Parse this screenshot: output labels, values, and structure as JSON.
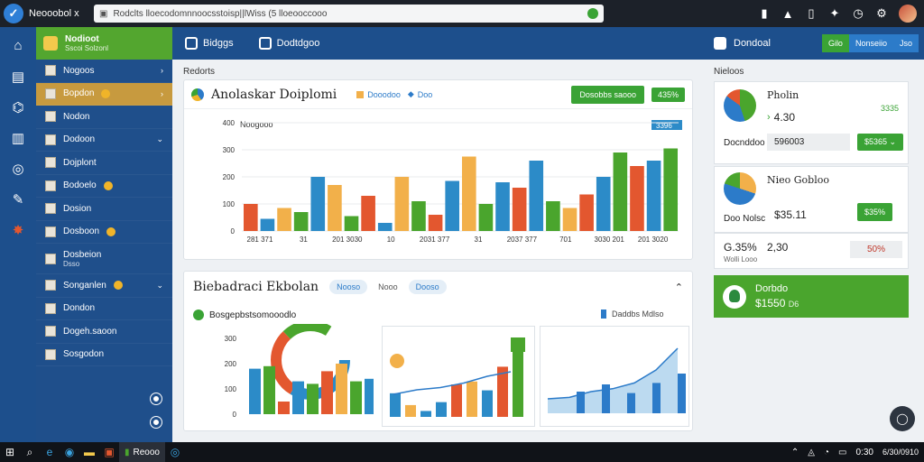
{
  "browser": {
    "tab_title": "Neooobol x",
    "url": "Rodclts  lloecodomnnoocsstoisp||lWiss (5  lloeooccooo",
    "icons": [
      "shield-icon",
      "warning-icon",
      "battery-icon",
      "puzzle-icon",
      "clock-icon",
      "settings-icon"
    ]
  },
  "sidebar": {
    "header_title": "Nodioot",
    "header_sub": "Sscoi Solzonl",
    "items": [
      {
        "label": "Nogoos",
        "chevron": "›"
      },
      {
        "label": "Bopdon",
        "chevron": "›",
        "active": true,
        "badge": true
      },
      {
        "label": "Nodon"
      },
      {
        "label": "Dodoon",
        "chevron": "⌄"
      },
      {
        "label": "Dojplont"
      },
      {
        "label": "Bodoelo",
        "badge": true
      },
      {
        "label": "Dosion"
      },
      {
        "label": "Dosboon",
        "badge": true
      },
      {
        "label": "Dosbeion",
        "sub": "Dsso"
      },
      {
        "label": "Songanlen",
        "badge": true,
        "chevron": "⌄"
      },
      {
        "label": "Dondon"
      },
      {
        "label": "Dogeh.saoon"
      },
      {
        "label": "Sosgodon"
      }
    ]
  },
  "header": {
    "nav1": "Bidggs",
    "nav2": "Dodtdgoo",
    "right_title": "Dondoal",
    "pill1": "Gilo",
    "pill2": "Nonseiio",
    "pill3": "Jso"
  },
  "main": {
    "section_label": "Redorts",
    "card1": {
      "title": "Anolaskar Doiplomi",
      "legend1": "Dooodoo",
      "legend2": "Doo",
      "btn1": "Dosobbs saooo",
      "btn2": "435%",
      "tag": "3396",
      "axis_label": "Noogooo"
    },
    "card2": {
      "title": "Biebadraci Ekbolan",
      "chip1": "Nooso",
      "chip2": "Nooo",
      "chip3": "Dooso",
      "sub_title": "Bosgepbstsomooodlo",
      "legend": "Daddbs Mdlso"
    }
  },
  "right": {
    "section_label": "Nieloos",
    "card1": {
      "title": "Pholin",
      "value": "4.30",
      "change": "3335",
      "row_label": "Docnddoo",
      "row_value": "596003",
      "btn": "$5365"
    },
    "card2": {
      "title": "Nieo Gobloo",
      "row_label": "Doo Nolsc",
      "value": "$35.11",
      "btn": "$35%"
    },
    "card3": {
      "stat1": "G.35%",
      "sub1": "Wolli Looo",
      "stat2": "2,30",
      "pct": "50%"
    },
    "green": {
      "title": "Dorbdo",
      "value": "$1550",
      "unit": "D6"
    }
  },
  "chart_data": [
    {
      "type": "bar",
      "ylim": [
        0,
        400
      ],
      "yticks": [
        "0",
        "100",
        "200",
        "300",
        "400"
      ],
      "xticks": [
        "281 371",
        "31",
        "201 3030",
        "10",
        "2031 377",
        "31",
        "2037 377",
        "701",
        "3030 201",
        "201 3020"
      ],
      "colors": [
        "#e3572f",
        "#2c8bc8",
        "#f2b04a",
        "#4aa52d",
        "#2c8bc8",
        "#f2b04a",
        "#4aa52d",
        "#e3572f",
        "#2c8bc8",
        "#f2b04a",
        "#4aa52d",
        "#e3572f",
        "#2c8bc8",
        "#f2b04a",
        "#4aa52d",
        "#2c8bc8",
        "#e3572f",
        "#2c8bc8",
        "#4aa52d",
        "#f2b04a",
        "#e3572f",
        "#2c8bc8",
        "#4aa52d",
        "#e3572f",
        "#2c8bc8",
        "#4aa52d"
      ],
      "values": [
        100,
        45,
        85,
        70,
        200,
        170,
        55,
        130,
        30,
        200,
        110,
        60,
        185,
        275,
        100,
        180,
        160,
        260,
        110,
        85,
        135,
        200,
        290,
        240,
        260,
        305
      ]
    },
    {
      "type": "bar",
      "ylim": [
        0,
        300
      ],
      "yticks": [
        "0",
        "100",
        "200",
        "300"
      ],
      "values": [
        180,
        190,
        50,
        130,
        120,
        170,
        200,
        130,
        140
      ],
      "colors": [
        "#2c8bc8",
        "#4aa52d",
        "#e3572f",
        "#2c8bc8",
        "#4aa52d",
        "#e3572f",
        "#f2b04a",
        "#4aa52d",
        "#2c8bc8"
      ]
    },
    {
      "type": "bar",
      "values": [
        40,
        20,
        10,
        25,
        55,
        60,
        45,
        85,
        120
      ],
      "colors": [
        "#2c8bc8",
        "#f2b04a",
        "#2c8bc8",
        "#2c8bc8",
        "#e3572f",
        "#f2b04a",
        "#2c8bc8",
        "#e3572f",
        "#4aa52d"
      ],
      "line": [
        10,
        20,
        25,
        35,
        50,
        60
      ]
    },
    {
      "type": "area",
      "values": [
        20,
        22,
        30,
        34,
        42,
        60,
        90
      ],
      "bars": [
        30,
        40,
        28,
        42,
        55
      ]
    }
  ],
  "taskbar": {
    "app_label": "Reooo",
    "clock_time": "0:30",
    "clock_date": "6/30/0910"
  }
}
